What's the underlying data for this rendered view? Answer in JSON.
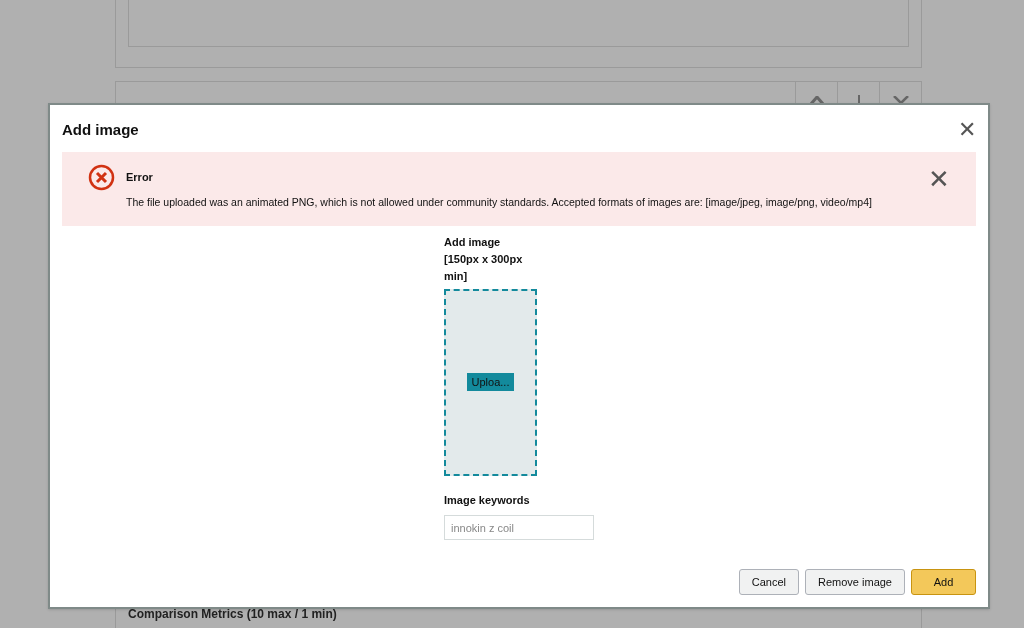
{
  "background": {
    "footer_label": "Comparison Metrics (10 max / 1 min)"
  },
  "dialog": {
    "title": "Add image",
    "close": "✕",
    "alert": {
      "kind": "error",
      "title": "Error",
      "message": "The file uploaded was an animated PNG, which is not allowed under community standards. Accepted formats of images are: [image/jpeg, image/png, video/mp4]",
      "dismiss": "✕"
    },
    "upload": {
      "label": "Add image [150px x 300px min]",
      "button": "Uploa..."
    },
    "keywords": {
      "label": "Image keywords",
      "placeholder": "innokin z coil"
    },
    "buttons": [
      {
        "label": "Cancel",
        "kind": "secondary"
      },
      {
        "label": "Remove image",
        "kind": "secondary"
      },
      {
        "label": "Add",
        "kind": "primary"
      }
    ]
  }
}
